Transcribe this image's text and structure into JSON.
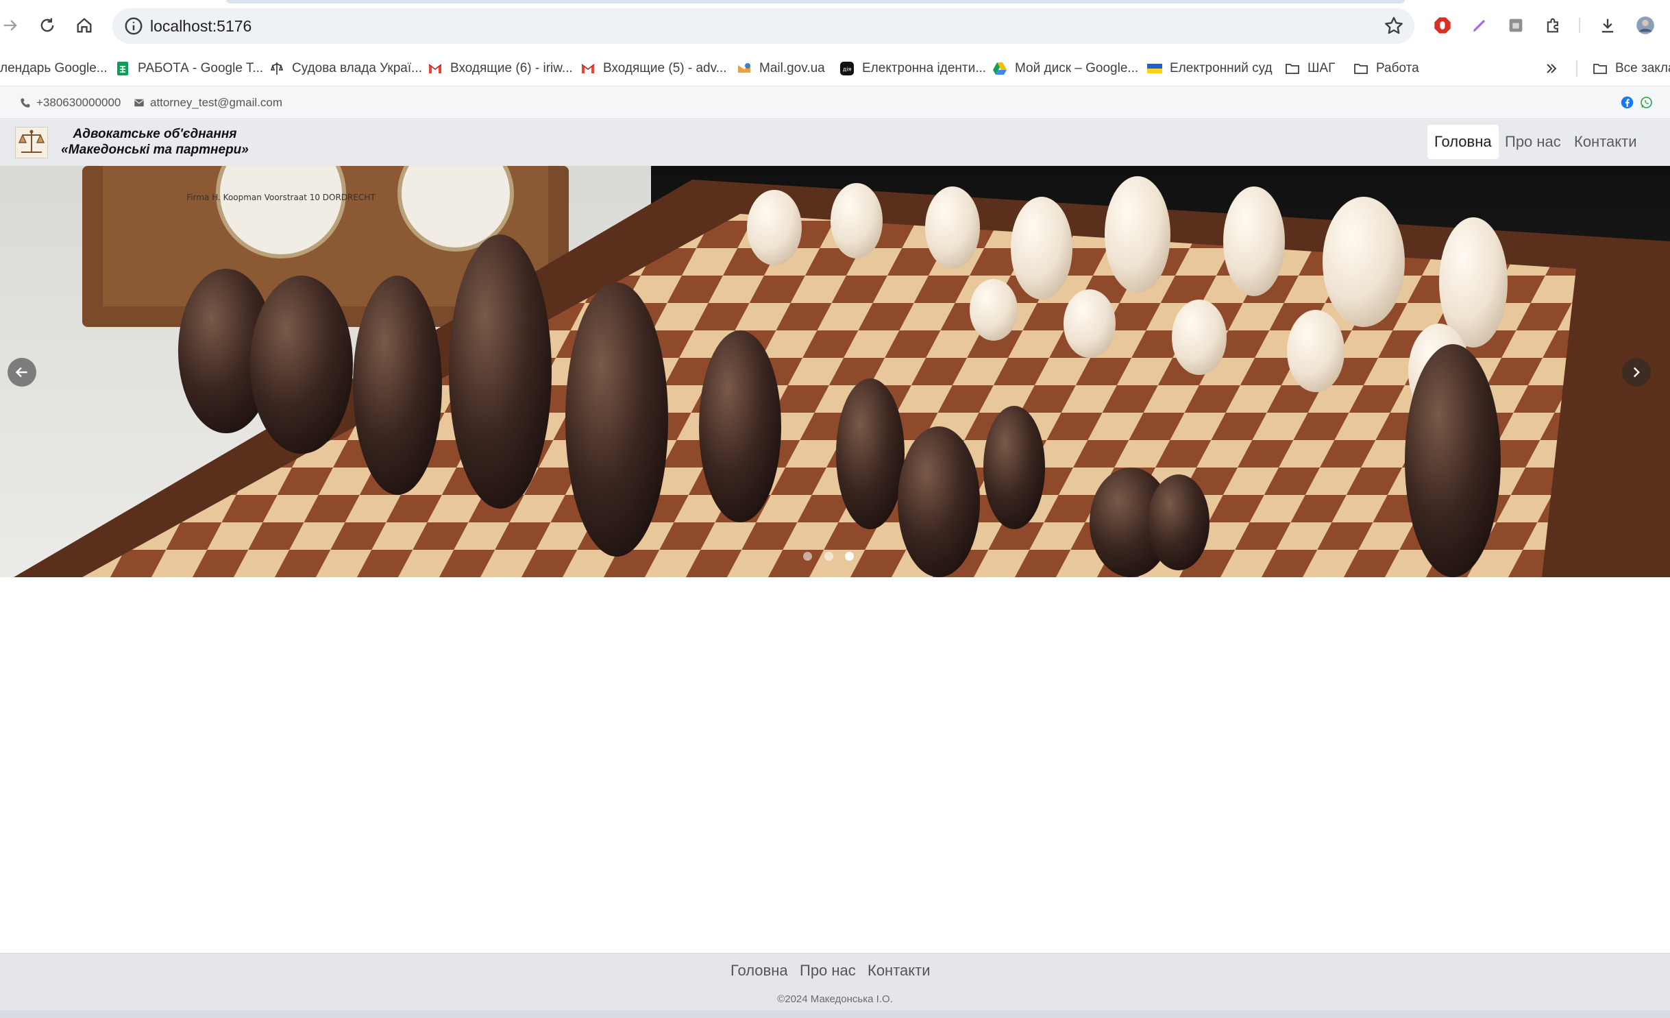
{
  "browser": {
    "url": "localhost:5176",
    "bookmarks": [
      {
        "label": "лендарь Google...",
        "icon": "calendar-icon"
      },
      {
        "label": "РАБОТА - Google T...",
        "icon": "sheets-icon"
      },
      {
        "label": "Судова влада Украї...",
        "icon": "court-icon"
      },
      {
        "label": "Входящие (6) - iriw...",
        "icon": "gmail-icon"
      },
      {
        "label": "Входящие (5) - adv...",
        "icon": "gmail-icon"
      },
      {
        "label": "Mail.gov.ua",
        "icon": "mail-gov-icon"
      },
      {
        "label": "Електронна іденти...",
        "icon": "diia-icon"
      },
      {
        "label": "Мой диск – Google...",
        "icon": "drive-icon"
      },
      {
        "label": "Електронний суд",
        "icon": "ukraine-flag-icon"
      },
      {
        "label": "ШАГ",
        "icon": "folder-icon"
      },
      {
        "label": "Работа",
        "icon": "folder-icon"
      }
    ],
    "all_bookmarks": "Все закла",
    "colors": {
      "omnibox": "#eef1f6",
      "accent": "#1a73e8"
    }
  },
  "contacts": {
    "phone": "+380630000000",
    "email": "attorney_test@gmail.com"
  },
  "header": {
    "brand_line1": "Адвокатське об'єднання",
    "brand_line2": "«Македонські та партнери»",
    "nav": [
      {
        "label": "Головна",
        "active": true
      },
      {
        "label": "Про нас",
        "active": false
      },
      {
        "label": "Контакти",
        "active": false
      }
    ]
  },
  "carousel": {
    "slide_count": 3,
    "active_slide": 3,
    "clock_text": "Firma H. Koopman Voorstraat 10 DORDRECHT"
  },
  "footer": {
    "nav": [
      "Головна",
      "Про нас",
      "Контакти"
    ],
    "copyright": "©2024 Македонська І.О."
  }
}
